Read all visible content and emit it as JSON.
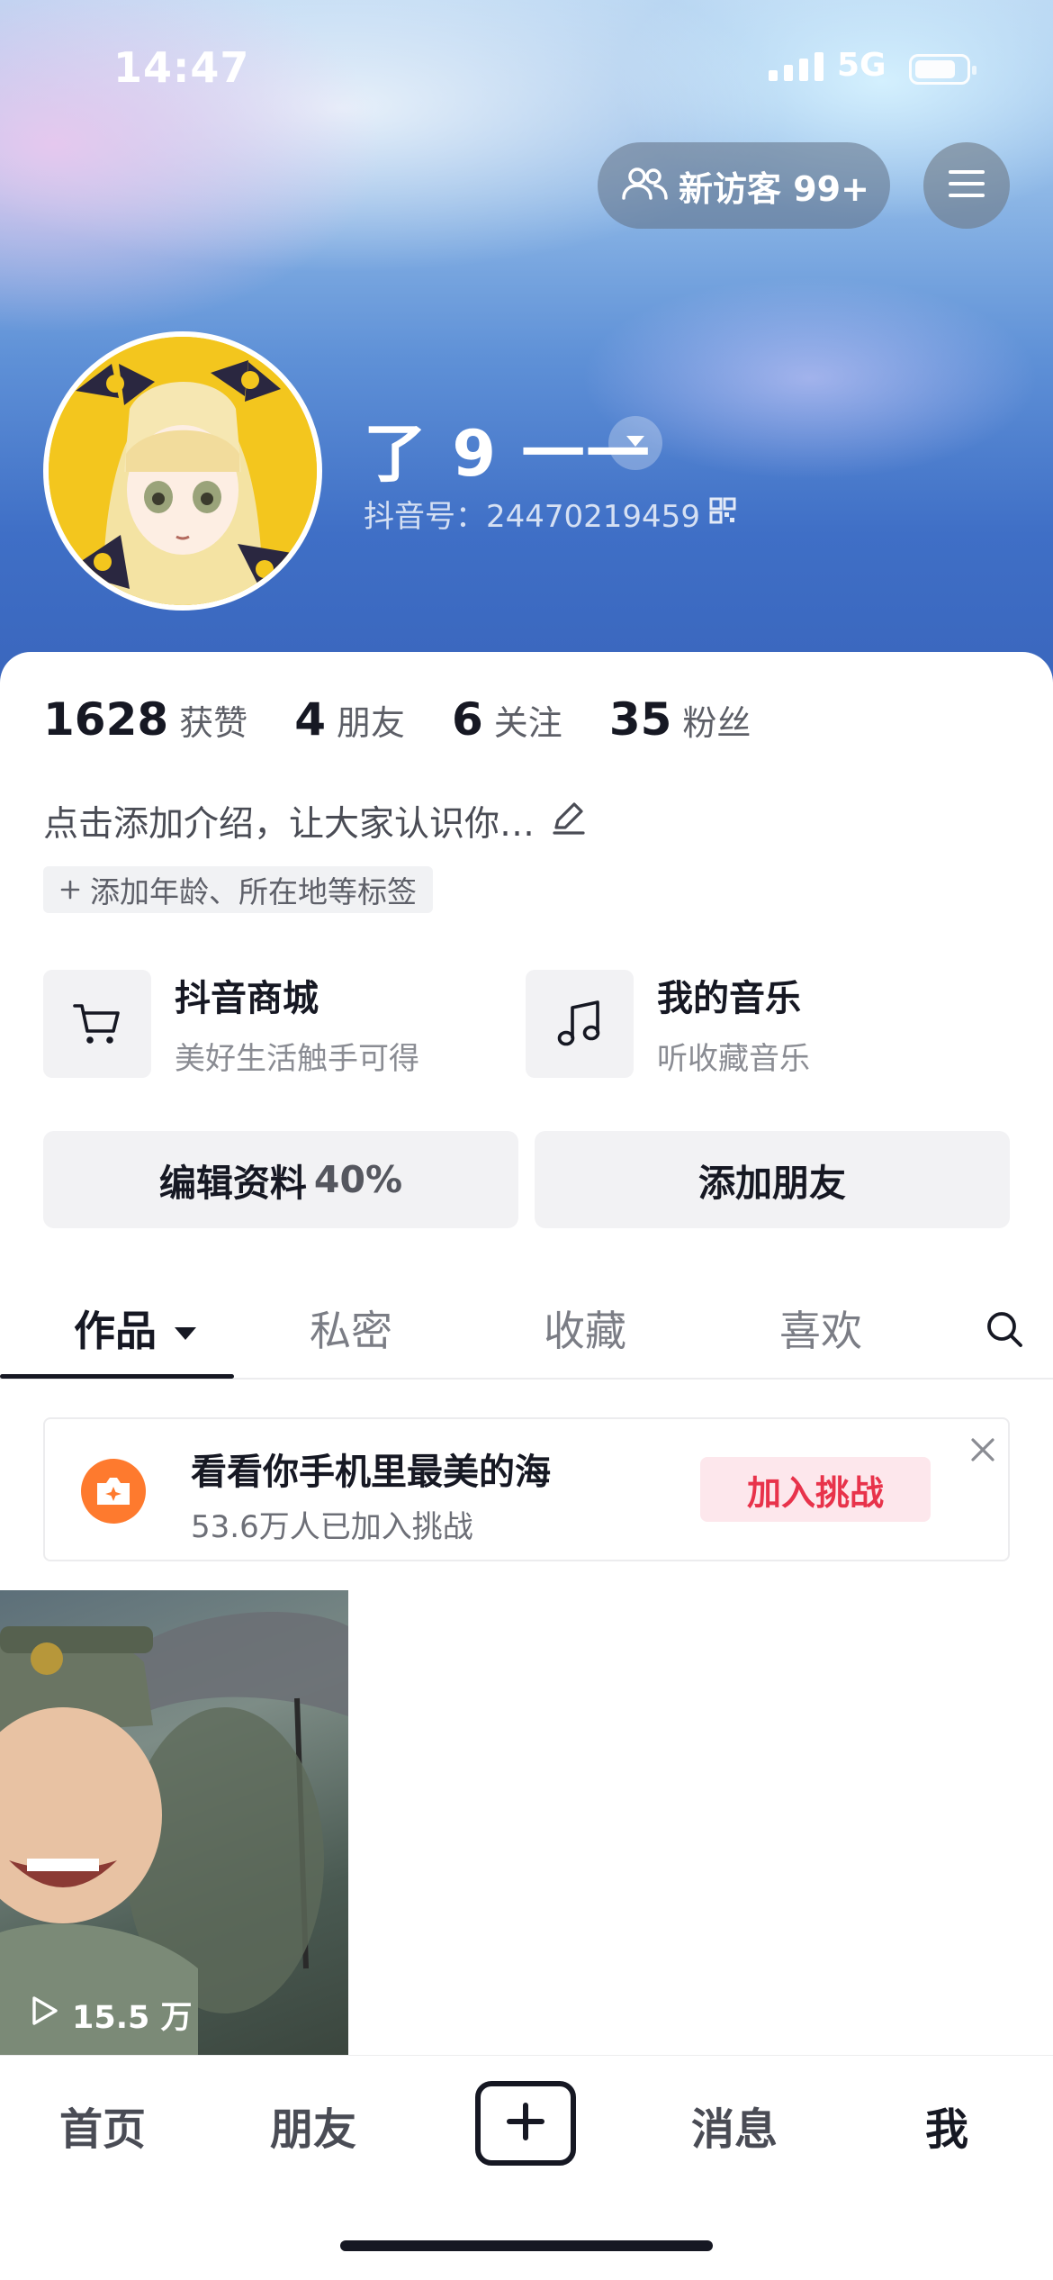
{
  "status_bar": {
    "time": "14:47",
    "network": "5G"
  },
  "header": {
    "visitor_label": "新访客 99+",
    "username": "了 9 一一",
    "douyin_id": "抖音号：24470219459"
  },
  "stats": [
    {
      "value": "1628",
      "label": "获赞"
    },
    {
      "value": "4",
      "label": "朋友"
    },
    {
      "value": "6",
      "label": "关注"
    },
    {
      "value": "35",
      "label": "粉丝"
    }
  ],
  "intro": {
    "text": "点击添加介绍，让大家认识你…",
    "tag_label": "添加年龄、所在地等标签"
  },
  "services": [
    {
      "title": "抖音商城",
      "subtitle": "美好生活触手可得",
      "icon": "cart-icon"
    },
    {
      "title": "我的音乐",
      "subtitle": "听收藏音乐",
      "icon": "music-note-icon"
    }
  ],
  "actions": {
    "edit_label": "编辑资料",
    "edit_percent": "40%",
    "add_friend_label": "添加朋友"
  },
  "tabs": [
    "作品",
    "私密",
    "收藏",
    "喜欢"
  ],
  "challenge": {
    "title": "看看你手机里最美的海",
    "subtitle": "53.6万人已加入挑战",
    "button": "加入挑战"
  },
  "video": {
    "plays": "15.5 万"
  },
  "bottom_nav": [
    "首页",
    "朋友",
    "消息",
    "我"
  ],
  "colors": {
    "accent_red": "#e8334b",
    "hero_blue": "#3f6fc6",
    "challenge_orange": "#fe7a2e"
  }
}
